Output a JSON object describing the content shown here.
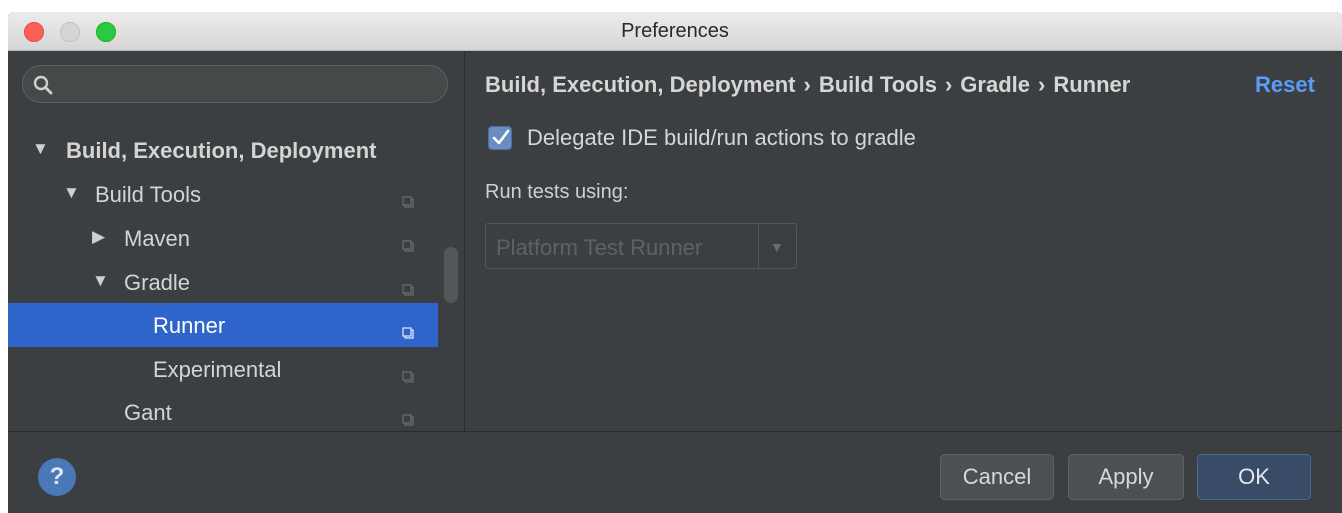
{
  "window": {
    "title": "Preferences"
  },
  "search": {
    "placeholder": "",
    "icon": "search-icon"
  },
  "tree": {
    "items": [
      {
        "label": "Build, Execution, Deployment",
        "expanded": true,
        "arrow": "▼"
      },
      {
        "label": "Build Tools",
        "expanded": true,
        "arrow": "▼"
      },
      {
        "label": "Maven",
        "expanded": false,
        "arrow": "▶"
      },
      {
        "label": "Gradle",
        "expanded": true,
        "arrow": "▼"
      },
      {
        "label": "Runner",
        "selected": true
      },
      {
        "label": "Experimental"
      },
      {
        "label": "Gant"
      }
    ]
  },
  "breadcrumb": {
    "items": [
      "Build, Execution, Deployment",
      "Build Tools",
      "Gradle",
      "Runner"
    ],
    "separator": "›"
  },
  "reset_label": "Reset",
  "delegate": {
    "label": "Delegate IDE build/run actions to gradle",
    "checked": true
  },
  "run_tests": {
    "label": "Run tests using:",
    "value": "Platform Test Runner"
  },
  "buttons": {
    "help": "?",
    "cancel": "Cancel",
    "apply": "Apply",
    "ok": "OK"
  },
  "colors": {
    "selection": "#2f65ca",
    "link": "#589df6",
    "background": "#3c3f41",
    "default_button": "#384c67"
  }
}
